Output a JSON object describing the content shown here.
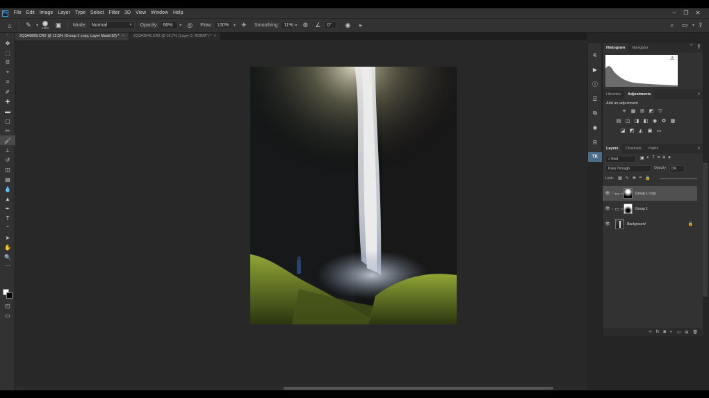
{
  "app": {
    "logo": "Ps"
  },
  "menu": [
    "File",
    "Edit",
    "Image",
    "Layer",
    "Type",
    "Select",
    "Filter",
    "3D",
    "View",
    "Window",
    "Help"
  ],
  "window_controls": {
    "minimize": "–",
    "restore": "❐",
    "close": "✕"
  },
  "options": {
    "brush_size": "1384",
    "mode_label": "Mode:",
    "mode_value": "Normal",
    "opacity_label": "Opacity:",
    "opacity_value": "66%",
    "flow_label": "Flow:",
    "flow_value": "100%",
    "smoothing_label": "Smoothing:",
    "smoothing_value": "11%",
    "angle_value": "0°"
  },
  "tabs": [
    {
      "label": "2Q3A6898.CR2 @ 12,5% (Group 1 copy, Layer Mask/16) *",
      "close": "×",
      "active": true
    },
    {
      "label": "2Q3A3545.CR2 @ 16,7% (Layer 0, RGB/8*) *",
      "close": "×",
      "active": false
    }
  ],
  "panels": {
    "top_tabs": [
      "Histogram",
      "Navigator"
    ],
    "mid_tabs": [
      "Libraries",
      "Adjustments"
    ],
    "adjust_title": "Add an adjustment",
    "layer_tabs": [
      "Layers",
      "Channels",
      "Paths"
    ],
    "kind_label": "Kind",
    "blend_mode": "Pass Through",
    "opacity_label": "Opacity:",
    "opacity_value": "0%",
    "lock_label": "Lock:"
  },
  "layers": [
    {
      "name": "Group 1 copy",
      "selected": true
    },
    {
      "name": "Group 1",
      "selected": false
    },
    {
      "name": "Background",
      "selected": false
    }
  ],
  "colors": {
    "accent": "#31a8ff",
    "ui_dark": "#323232",
    "canvas_bg": "#282828"
  }
}
